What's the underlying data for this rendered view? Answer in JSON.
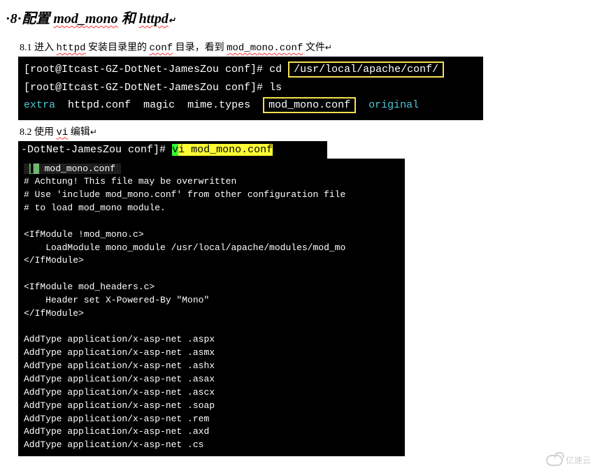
{
  "heading": {
    "bullet": "·",
    "num": "8",
    "sep": "·",
    "t1": "配置",
    "t2": "mod_mono",
    "t3": "和",
    "t4": "httpd",
    "arrow": "↵"
  },
  "s81": {
    "num": "8.1",
    "t1": "进入",
    "httpd": "httpd",
    "t2": "安装目录里的",
    "conf": "conf",
    "t3": "目录，看到",
    "mfile": "mod_mono.conf",
    "t4": "文件",
    "arrow": "↵"
  },
  "term1": {
    "l1_prompt": "[root@Itcast-GZ-DotNet-JamesZou conf]#",
    "l1_cmd": "cd",
    "l1_path": "/usr/local/apache/conf/",
    "l2_prompt": "[root@Itcast-GZ-DotNet-JamesZou conf]#",
    "l2_cmd": "ls",
    "l3_extra": "extra",
    "l3_httpd": "httpd.conf",
    "l3_magic": "magic",
    "l3_mime": "mime.types",
    "l3_mod": "mod_mono.conf",
    "l3_orig": "original"
  },
  "s82": {
    "num": "8.2",
    "t1": "使用",
    "vi": "vi",
    "t2": "编辑",
    "arrow": "↵"
  },
  "term2": {
    "prompt": "-DotNet-JamesZou conf]#",
    "pre": " ",
    "v": "v",
    "rest": "i mod_mono.conf "
  },
  "term3": {
    "tabmark": "▍",
    "tabname": "mod_mono.conf",
    "body": "\n# Achtung! This file may be overwritten\n# Use 'include mod_mono.conf' from other configuration file\n# to load mod_mono module.\n\n<IfModule !mod_mono.c>\n    LoadModule mono_module /usr/local/apache/modules/mod_mo\n</IfModule>\n\n<IfModule mod_headers.c>\n    Header set X-Powered-By \"Mono\"\n</IfModule>\n\nAddType application/x-asp-net .aspx\nAddType application/x-asp-net .asmx\nAddType application/x-asp-net .ashx\nAddType application/x-asp-net .asax\nAddType application/x-asp-net .ascx\nAddType application/x-asp-net .soap\nAddType application/x-asp-net .rem\nAddType application/x-asp-net .axd\nAddType application/x-asp-net .cs"
  },
  "watermark": "亿速云"
}
